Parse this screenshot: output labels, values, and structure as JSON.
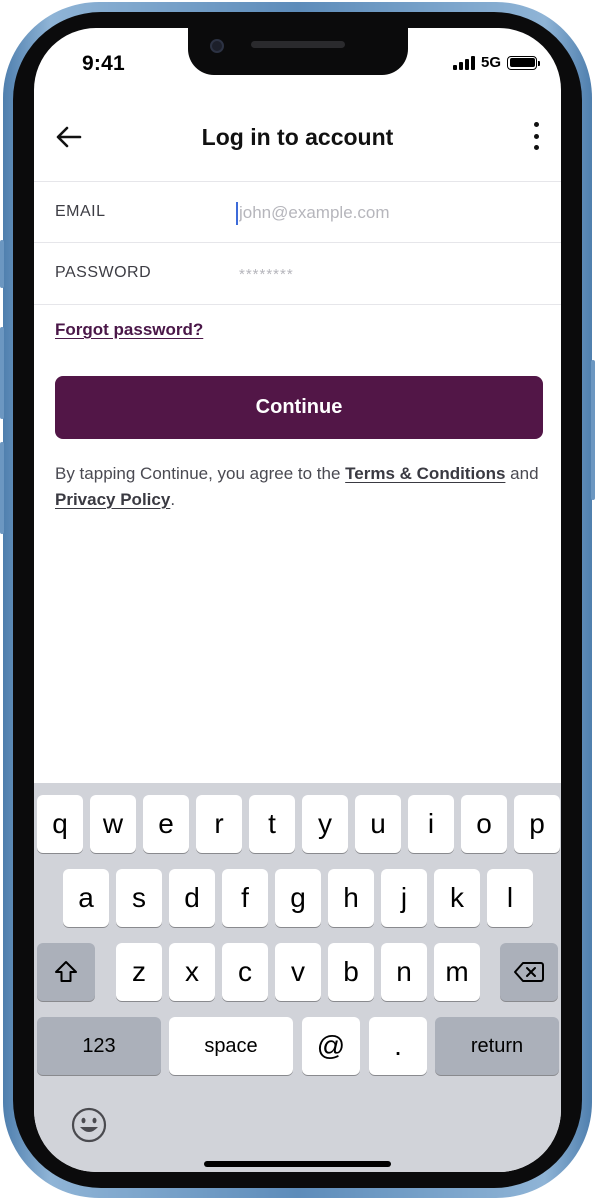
{
  "status_bar": {
    "time": "9:41",
    "network": "5G"
  },
  "header": {
    "title": "Log in to account",
    "back_icon": "arrow-left-icon",
    "menu_icon": "more-vertical-icon"
  },
  "form": {
    "email": {
      "label": "EMAIL",
      "placeholder": "john@example.com",
      "value": ""
    },
    "password": {
      "label": "PASSWORD",
      "placeholder": "********",
      "value": ""
    },
    "forgot_link": "Forgot password?",
    "continue_label": "Continue"
  },
  "legal": {
    "prefix": "By tapping Continue, you agree to the",
    "terms": "Terms & Conditions",
    "middle": "and",
    "privacy": "Privacy Policy",
    "suffix": "."
  },
  "keyboard": {
    "row1": [
      "q",
      "w",
      "e",
      "r",
      "t",
      "y",
      "u",
      "i",
      "o",
      "p"
    ],
    "row2": [
      "a",
      "s",
      "d",
      "f",
      "g",
      "h",
      "j",
      "k",
      "l"
    ],
    "row3": [
      "z",
      "x",
      "c",
      "v",
      "b",
      "n",
      "m"
    ],
    "numbers_label": "123",
    "space_label": "space",
    "at_label": "@",
    "dot_label": ".",
    "return_label": "return",
    "shift_icon": "shift-icon",
    "delete_icon": "backspace-icon",
    "emoji_icon": "emoji-icon"
  },
  "colors": {
    "primary": "#521647",
    "link": "#4a1748",
    "keyboard_bg": "#d1d3d9",
    "frame": "#5d8cba"
  }
}
